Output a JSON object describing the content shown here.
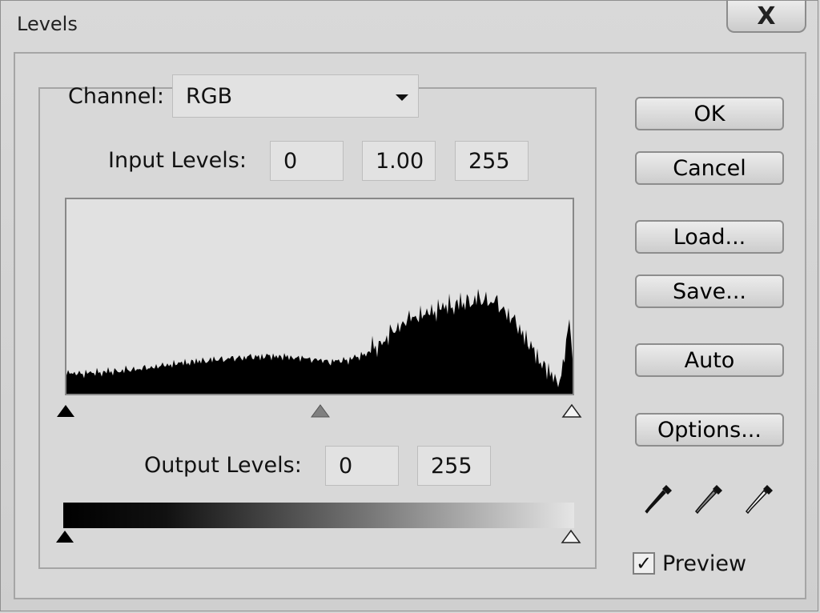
{
  "window": {
    "title": "Levels",
    "close_label": "X"
  },
  "channel": {
    "label": "Channel:",
    "value": "RGB"
  },
  "input_levels": {
    "label": "Input Levels:",
    "black": "0",
    "gamma": "1.00",
    "white": "255"
  },
  "output_levels": {
    "label": "Output Levels:",
    "black": "0",
    "white": "255"
  },
  "buttons": {
    "ok": "OK",
    "cancel": "Cancel",
    "load": "Load...",
    "save": "Save...",
    "auto": "Auto",
    "options": "Options..."
  },
  "preview": {
    "label": "Preview",
    "checked": true,
    "check_glyph": "✓"
  },
  "icons": {
    "black_eyedropper": "black-point-eyedropper-icon",
    "gray_eyedropper": "gray-point-eyedropper-icon",
    "white_eyedropper": "white-point-eyedropper-icon"
  },
  "colors": {
    "dialog": "#d4d4d4",
    "histogram": "#000000"
  }
}
